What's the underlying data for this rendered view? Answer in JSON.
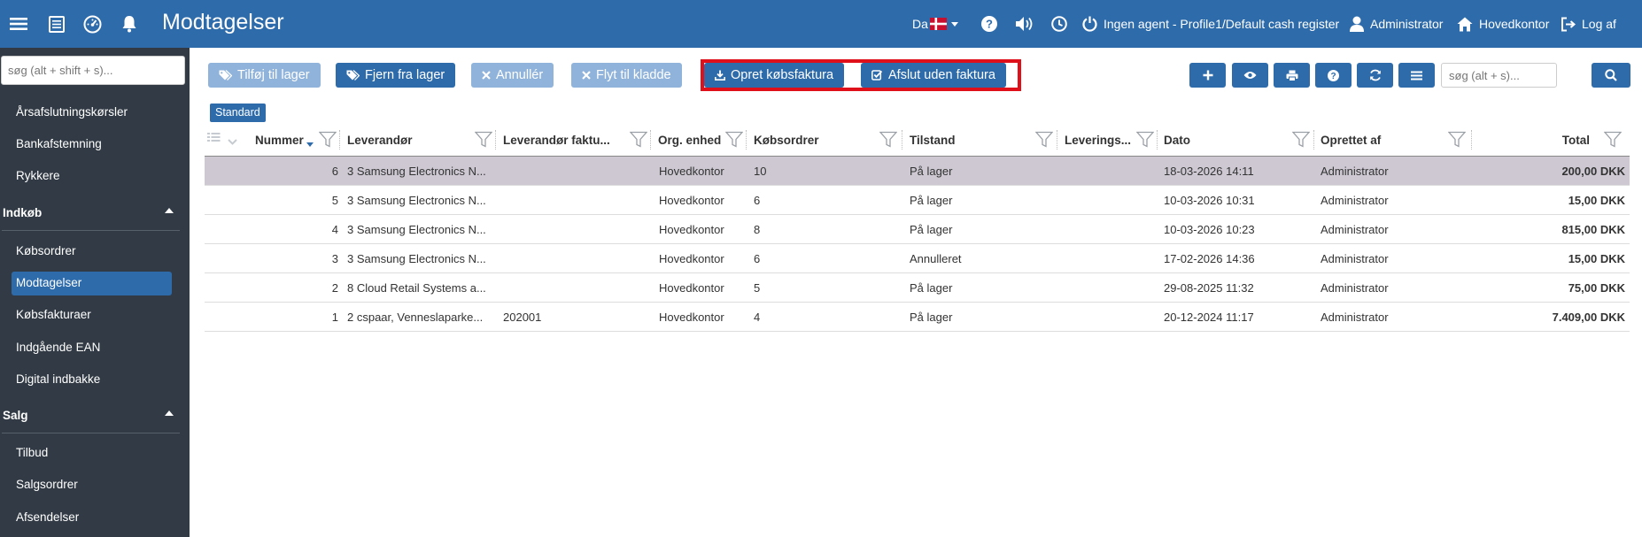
{
  "header": {
    "title": "Modtagelser",
    "language": "Da",
    "agent_status": "Ingen agent - Profile1/Default cash register",
    "user": "Administrator",
    "location": "Hovedkontor",
    "logout": "Log af"
  },
  "sidebar": {
    "search_placeholder": "søg (alt + shift + s)...",
    "items_top": [
      "Årsafslutningskørsler",
      "Bankafstemning",
      "Rykkere"
    ],
    "section_purchase": "Indkøb",
    "purchase_items": [
      "Købsordrer",
      "Modtagelser",
      "Købsfakturaer",
      "Indgående EAN",
      "Digital indbakke"
    ],
    "section_sales": "Salg",
    "sales_items": [
      "Tilbud",
      "Salgsordrer",
      "Afsendelser"
    ]
  },
  "toolbar": {
    "add_to_stock": "Tilføj til lager",
    "remove_from_stock": "Fjern fra lager",
    "cancel": "Annullér",
    "move_to_draft": "Flyt til kladde",
    "create_invoice": "Opret købsfaktura",
    "close_without_invoice": "Afslut uden faktura",
    "search_placeholder": "søg (alt + s)..."
  },
  "view": "Standard",
  "table": {
    "columns": [
      "Nummer",
      "Leverandør",
      "Leverandør faktu...",
      "Org. enhed",
      "Købsordrer",
      "Tilstand",
      "Leverings...",
      "Dato",
      "Oprettet af",
      "Total"
    ],
    "rows": [
      {
        "nummer": "6",
        "leverandor": "3 Samsung Electronics N...",
        "faktura": "",
        "org": "Hovedkontor",
        "kobsordrer": "10",
        "tilstand": "På lager",
        "levering": "",
        "dato": "18-03-2026 14:11",
        "oprettet": "Administrator",
        "total": "200,00 DKK",
        "selected": true
      },
      {
        "nummer": "5",
        "leverandor": "3 Samsung Electronics N...",
        "faktura": "",
        "org": "Hovedkontor",
        "kobsordrer": "6",
        "tilstand": "På lager",
        "levering": "",
        "dato": "10-03-2026 10:31",
        "oprettet": "Administrator",
        "total": "15,00 DKK",
        "selected": false
      },
      {
        "nummer": "4",
        "leverandor": "3 Samsung Electronics N...",
        "faktura": "",
        "org": "Hovedkontor",
        "kobsordrer": "8",
        "tilstand": "På lager",
        "levering": "",
        "dato": "10-03-2026 10:23",
        "oprettet": "Administrator",
        "total": "815,00 DKK",
        "selected": false
      },
      {
        "nummer": "3",
        "leverandor": "3 Samsung Electronics N...",
        "faktura": "",
        "org": "Hovedkontor",
        "kobsordrer": "6",
        "tilstand": "Annulleret",
        "levering": "",
        "dato": "17-02-2026 14:36",
        "oprettet": "Administrator",
        "total": "15,00 DKK",
        "selected": false
      },
      {
        "nummer": "2",
        "leverandor": "8 Cloud Retail Systems a...",
        "faktura": "",
        "org": "Hovedkontor",
        "kobsordrer": "5",
        "tilstand": "På lager",
        "levering": "",
        "dato": "29-08-2025 11:32",
        "oprettet": "Administrator",
        "total": "75,00 DKK",
        "selected": false
      },
      {
        "nummer": "1",
        "leverandor": "2 cspaar, Venneslaparke...",
        "faktura": "202001",
        "org": "Hovedkontor",
        "kobsordrer": "4",
        "tilstand": "På lager",
        "levering": "",
        "dato": "20-12-2024 11:17",
        "oprettet": "Administrator",
        "total": "7.409,00 DKK",
        "selected": false
      }
    ]
  },
  "colors": {
    "primary": "#2e6bab",
    "primary_light": "#8fb3da",
    "sidebar": "#323b45",
    "highlight": "#e0101a",
    "selected_row": "#cdc8d2"
  }
}
